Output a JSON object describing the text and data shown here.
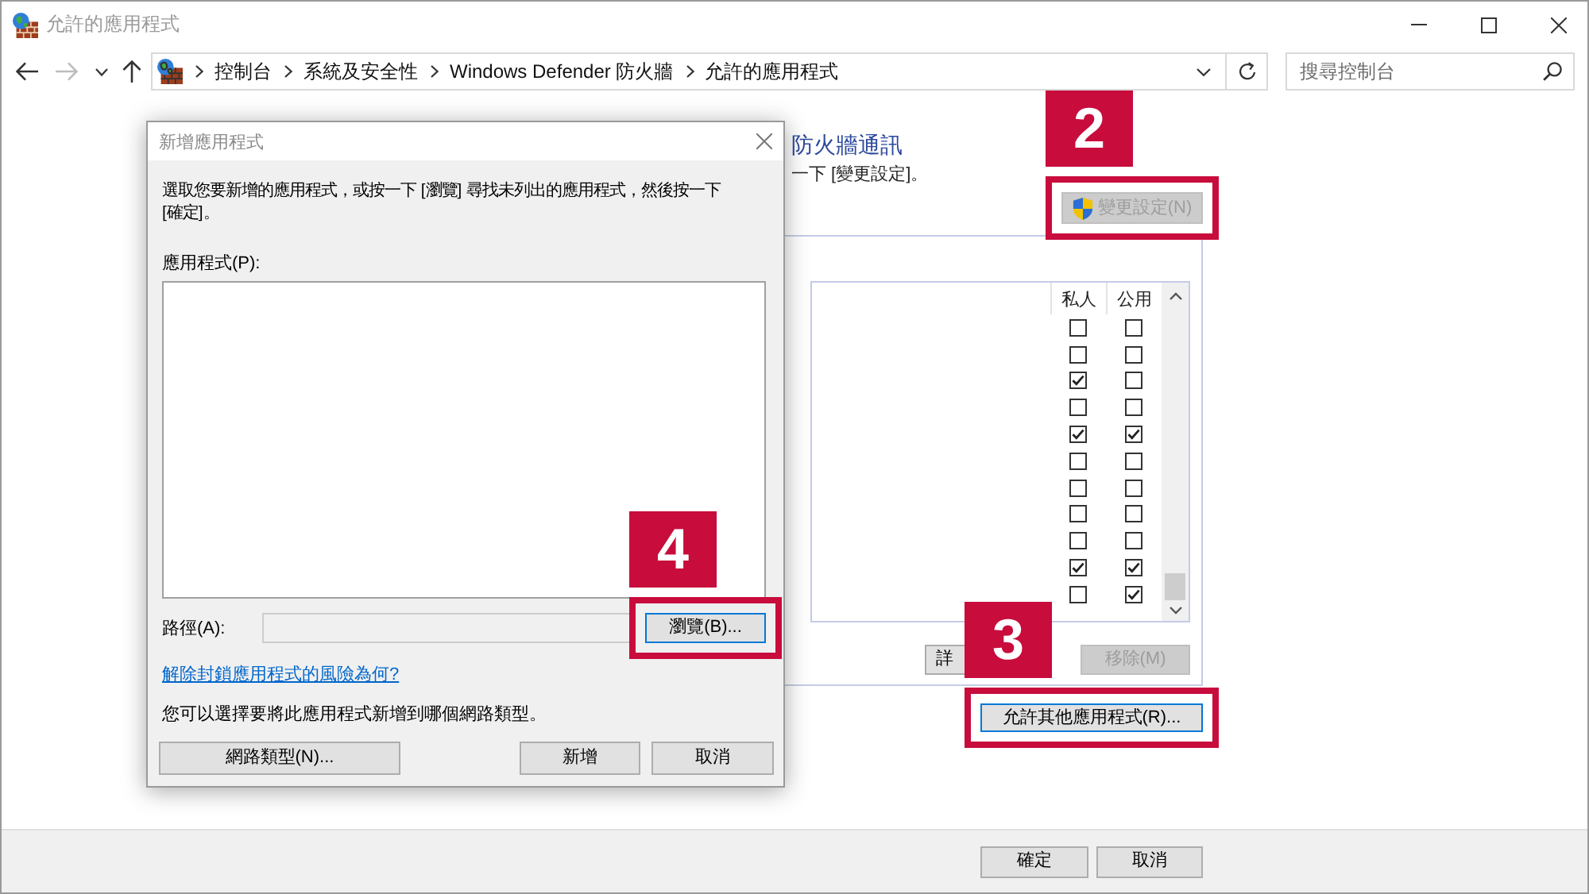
{
  "window": {
    "title": "允許的應用程式"
  },
  "navigation": [
    {
      "kind": "back",
      "disabled": false
    },
    {
      "kind": "forward",
      "disabled": true
    },
    {
      "kind": "recent",
      "disabled": false
    },
    {
      "kind": "up",
      "disabled": false
    }
  ],
  "address_bar": {
    "breadcrumbs": [
      "控制台",
      "系統及安全性",
      "Windows Defender 防火牆",
      "允許的應用程式"
    ]
  },
  "search": {
    "placeholder": "搜尋控制台"
  },
  "page": {
    "heading": "防火牆通訊",
    "instruction": "一下 [變更設定]。",
    "change_settings_button": {
      "label": "變更設定(N)",
      "disabled": true,
      "callout": "2"
    }
  },
  "allowed_apps": {
    "columns": [
      "私人",
      "公用"
    ],
    "rows": [
      {
        "checks": [
          false,
          false
        ]
      },
      {
        "checks": [
          false,
          false
        ]
      },
      {
        "checks": [
          true,
          false
        ]
      },
      {
        "checks": [
          false,
          false
        ]
      },
      {
        "checks": [
          true,
          true
        ]
      },
      {
        "checks": [
          false,
          false
        ]
      },
      {
        "checks": [
          false,
          false
        ]
      },
      {
        "checks": [
          false,
          false
        ]
      },
      {
        "checks": [
          false,
          false
        ]
      },
      {
        "checks": [
          true,
          true
        ]
      },
      {
        "checks": [
          false,
          true
        ]
      }
    ],
    "buttons": [
      {
        "label": "詳",
        "disabled": false
      },
      {
        "label": "移除(M)",
        "disabled": true
      }
    ]
  },
  "allow_another_button": {
    "label": "允許其他應用程式(R)...",
    "focused": true,
    "callout": "3"
  },
  "footer_buttons": [
    "確定",
    "取消"
  ],
  "dialog": {
    "title": "新增應用程式",
    "instruction": "選取您要新增的應用程式，或按一下 [瀏覽] 尋找未列出的應用程式，然後按一下 [確定]。",
    "apps_label": "應用程式(P):",
    "path_label": "路徑(A):",
    "path_field": {
      "disabled": true
    },
    "browse_button": {
      "label": "瀏覽(B)...",
      "focused": true,
      "callout": "4"
    },
    "risk_link": "解除封鎖應用程式的風險為何?",
    "network_note": "您可以選擇要將此應用程式新增到哪個網路類型。",
    "buttons": [
      "網路類型(N)...",
      "新增",
      "取消"
    ]
  }
}
